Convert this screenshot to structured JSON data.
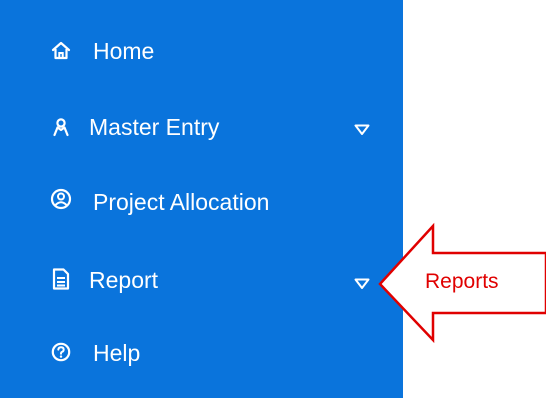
{
  "colors": {
    "sidebar_bg": "#0a74dc",
    "menu_text": "#ffffff",
    "annotation": "#e00000"
  },
  "sidebar": {
    "items": [
      {
        "label": "Home",
        "icon": "home-icon",
        "has_dropdown": false
      },
      {
        "label": "Master Entry",
        "icon": "user-icon",
        "has_dropdown": true
      },
      {
        "label": "Project Allocation",
        "icon": "user-circle-icon",
        "has_dropdown": false
      },
      {
        "label": "Report",
        "icon": "document-icon",
        "has_dropdown": true
      },
      {
        "label": "Help",
        "icon": "help-circle-icon",
        "has_dropdown": false
      }
    ]
  },
  "annotation": {
    "label": "Reports",
    "shape": "arrow-left",
    "points_to": "Report"
  }
}
